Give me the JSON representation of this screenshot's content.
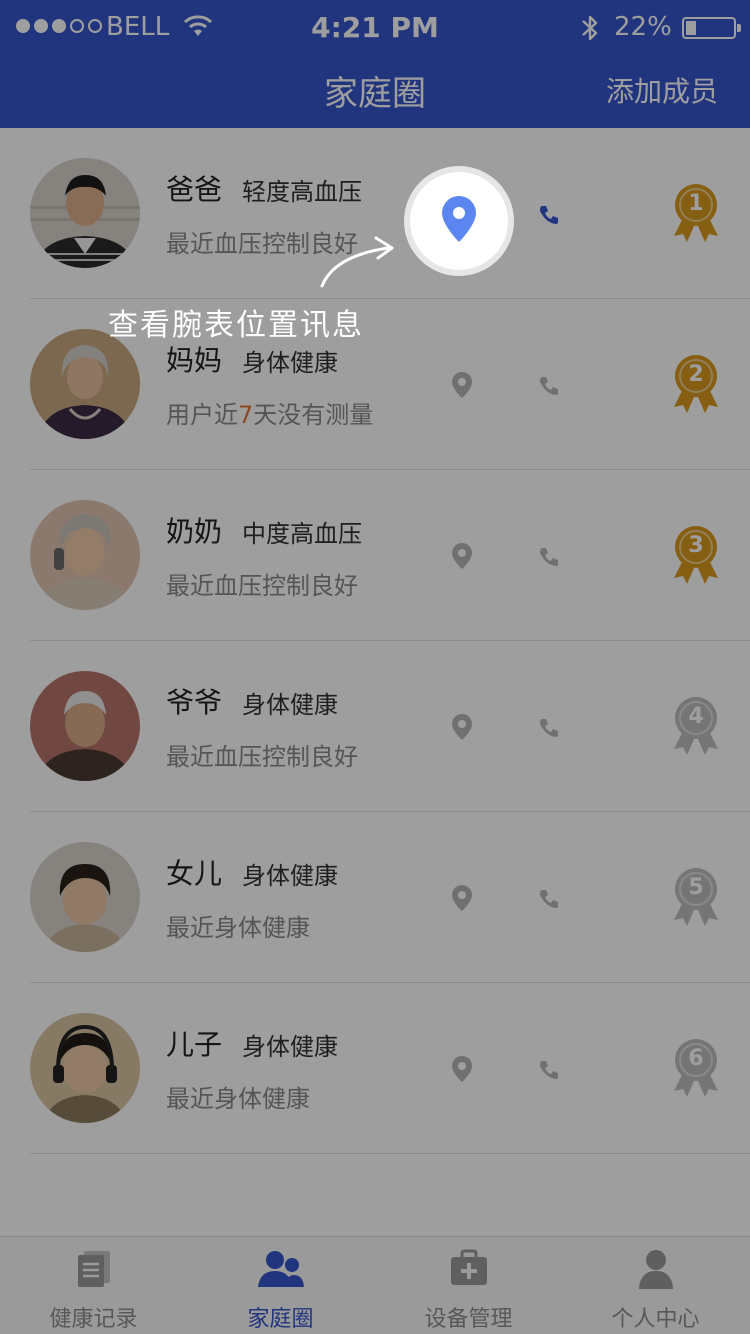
{
  "status_bar": {
    "carrier": "BELL",
    "time": "4:21 PM",
    "battery": "22%",
    "battery_level": 0.22
  },
  "nav": {
    "title": "家庭圈",
    "add_member": "添加成员"
  },
  "members": [
    {
      "name": "爸爸",
      "condition": "轻度高血压",
      "status": "最近血压控制良好",
      "rank": "1"
    },
    {
      "name": "妈妈",
      "condition": "身体健康",
      "status_pre": "用户近",
      "status_hl": "7",
      "status_post": "天没有测量",
      "rank": "2"
    },
    {
      "name": "奶奶",
      "condition": "中度高血压",
      "status": "最近血压控制良好",
      "rank": "3"
    },
    {
      "name": "爷爷",
      "condition": "身体健康",
      "status": "最近血压控制良好",
      "rank": "4"
    },
    {
      "name": "女儿",
      "condition": "身体健康",
      "status": "最近身体健康",
      "rank": "5"
    },
    {
      "name": "儿子",
      "condition": "身体健康",
      "status": "最近身体健康",
      "rank": "6"
    }
  ],
  "tabs": [
    {
      "label": "健康记录",
      "icon": "clipboard-icon"
    },
    {
      "label": "家庭圈",
      "icon": "family-icon",
      "active": true
    },
    {
      "label": "设备管理",
      "icon": "medical-kit-icon"
    },
    {
      "label": "个人中心",
      "icon": "person-icon"
    }
  ],
  "coachmark": {
    "hint": "查看腕表位置讯息"
  },
  "colors": {
    "primary": "#3654cc",
    "gold_medal": "#d89a1e",
    "grey_medal": "#bdbdbd",
    "highlight_text": "#e0773a"
  }
}
